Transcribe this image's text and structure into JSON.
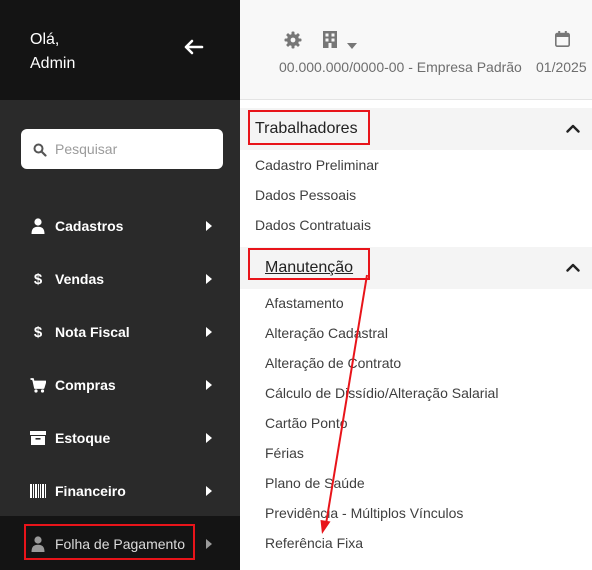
{
  "sidebar": {
    "greeting_line1": "Olá,",
    "greeting_line2": "Admin",
    "collapse_icon": "arrow-left-icon",
    "search_placeholder": "Pesquisar",
    "items": [
      {
        "label": "Cadastros",
        "icon": "user-icon"
      },
      {
        "label": "Vendas",
        "icon": "dollar-icon"
      },
      {
        "label": "Nota Fiscal",
        "icon": "dollar-icon"
      },
      {
        "label": "Compras",
        "icon": "cart-icon"
      },
      {
        "label": "Estoque",
        "icon": "archive-box-icon"
      },
      {
        "label": "Financeiro",
        "icon": "barcode-icon"
      },
      {
        "label": "Folha de Pagamento",
        "icon": "user-icon",
        "active": true
      }
    ]
  },
  "header": {
    "settings_icon": "gear-icon",
    "company_icon": "building-icon",
    "company": "00.000.000/0000-00 - Empresa Padrão",
    "calendar_icon": "calendar-icon",
    "period": "01/2025"
  },
  "submenu": {
    "sections": [
      {
        "title": "Trabalhadores",
        "items": [
          "Cadastro Preliminar",
          "Dados Pessoais",
          "Dados Contratuais"
        ]
      },
      {
        "title": "Manutenção",
        "items": [
          "Afastamento",
          "Alteração Cadastral",
          "Alteração de Contrato",
          "Cálculo de Dissídio/Alteração Salarial",
          "Cartão Ponto",
          "Férias",
          "Plano de Saúde",
          "Previdência - Múltiplos Vínculos",
          "Referência Fixa"
        ]
      }
    ]
  },
  "colors": {
    "sidebar_dark": "#141414",
    "sidebar_body": "#2a2a2a",
    "annotation_red": "#e8141a"
  }
}
